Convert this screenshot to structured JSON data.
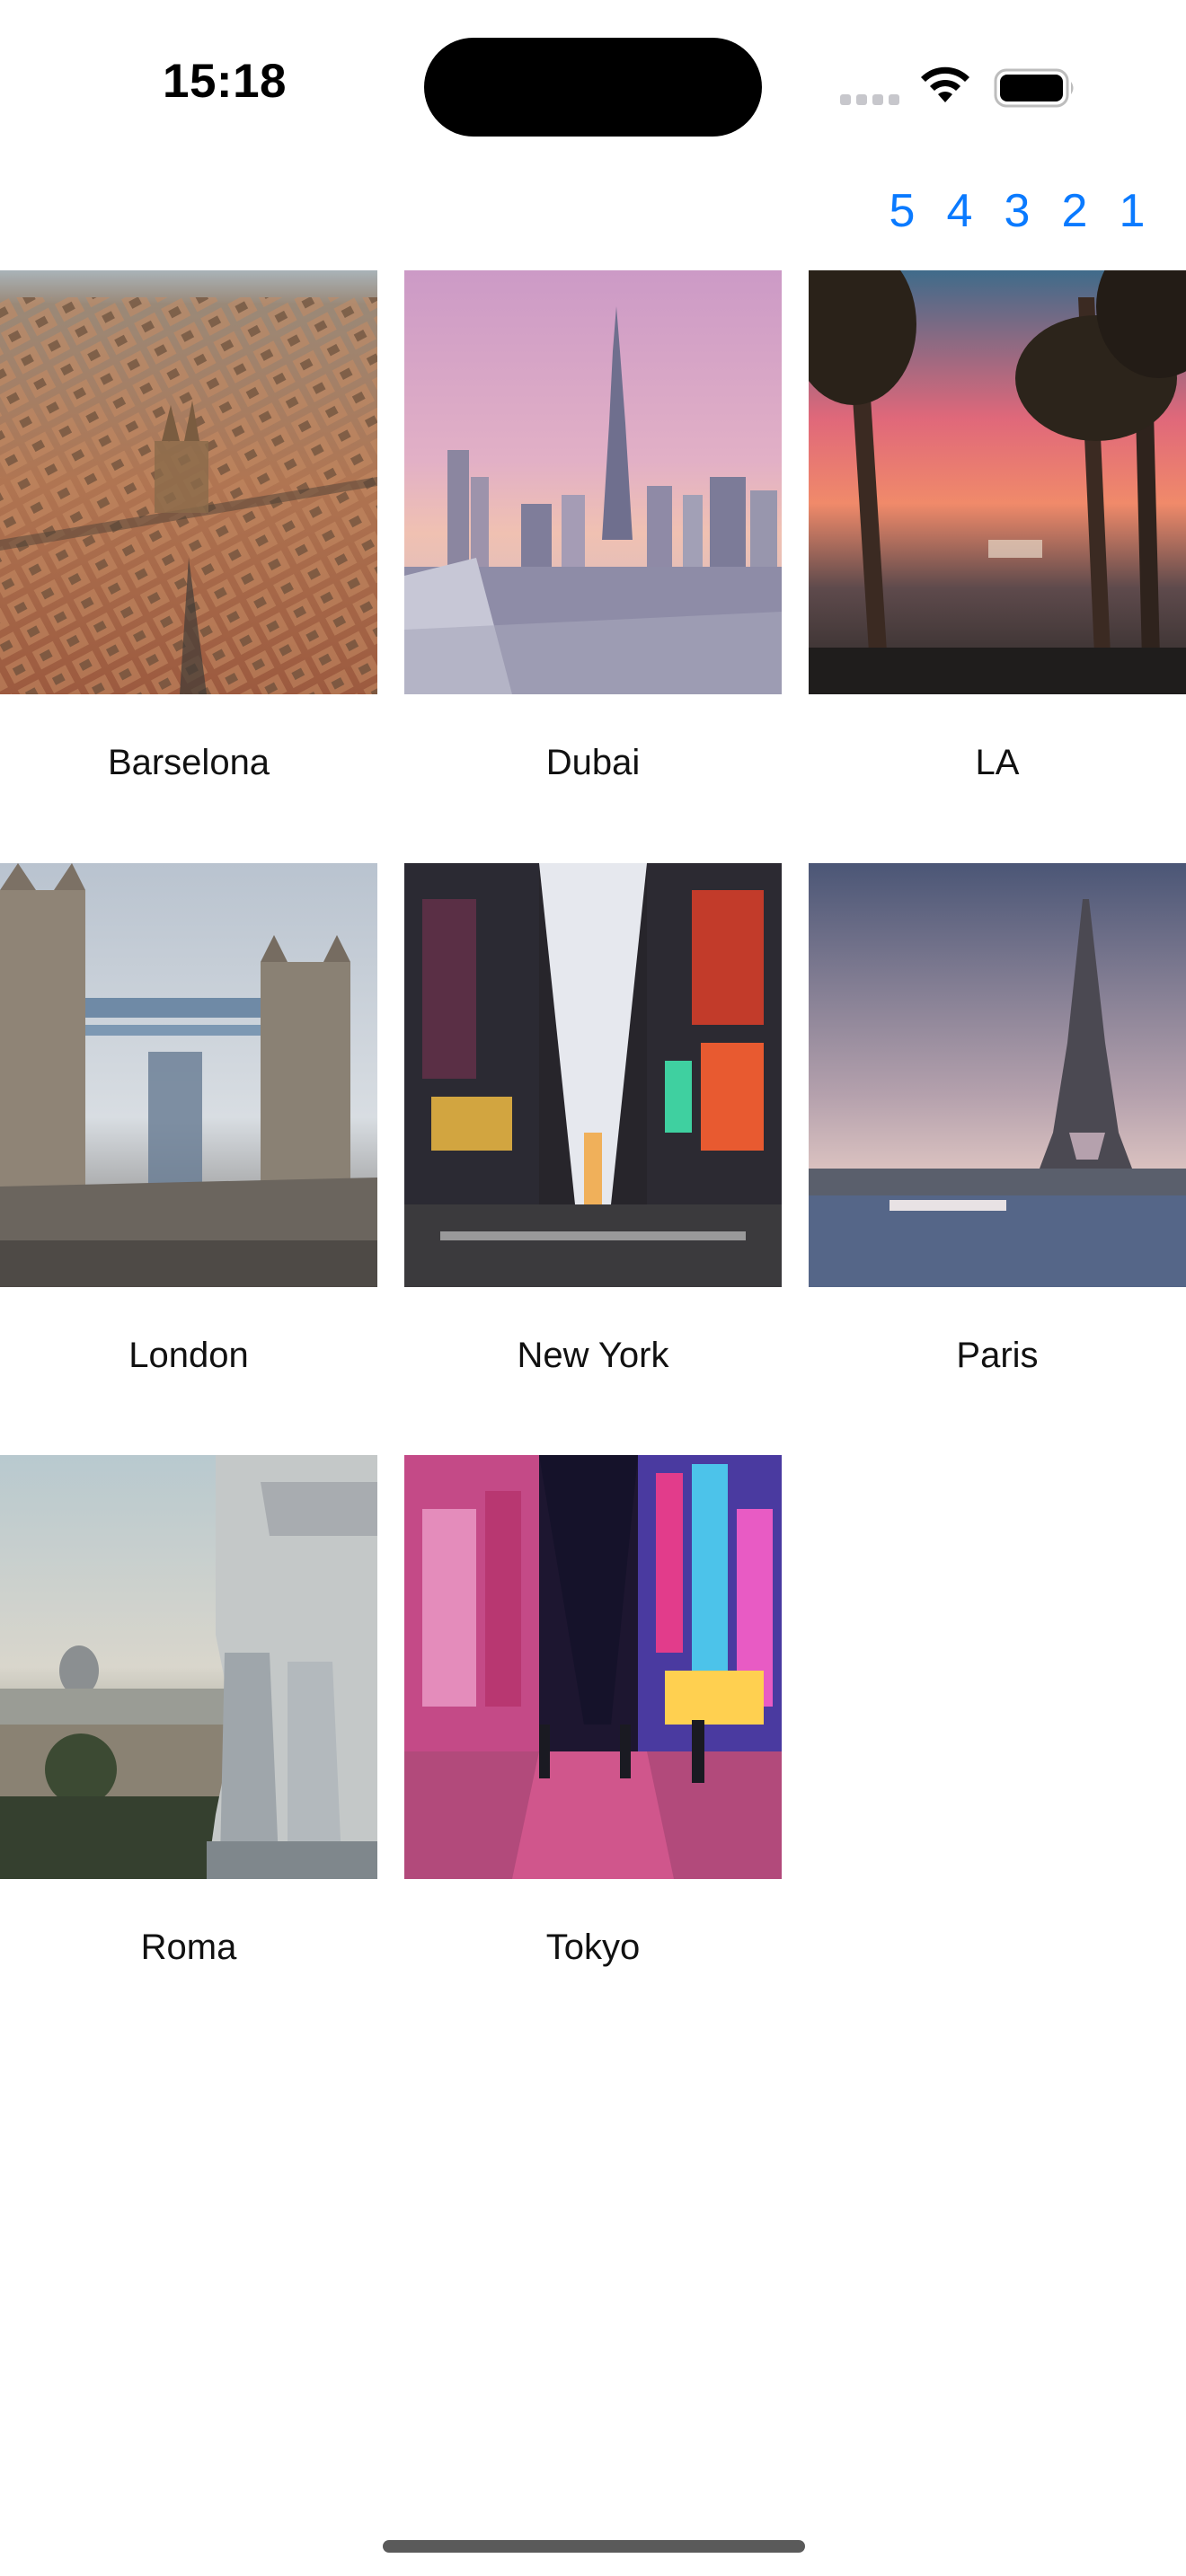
{
  "status_bar": {
    "time": "15:18"
  },
  "toolbar": {
    "buttons": [
      "5",
      "4",
      "3",
      "2",
      "1"
    ]
  },
  "cities": [
    {
      "name": "Barselona"
    },
    {
      "name": "Dubai"
    },
    {
      "name": "LA"
    },
    {
      "name": "London"
    },
    {
      "name": "New York"
    },
    {
      "name": "Paris"
    },
    {
      "name": "Roma"
    },
    {
      "name": "Tokyo"
    }
  ],
  "colors": {
    "accent": "#0a7aff"
  }
}
